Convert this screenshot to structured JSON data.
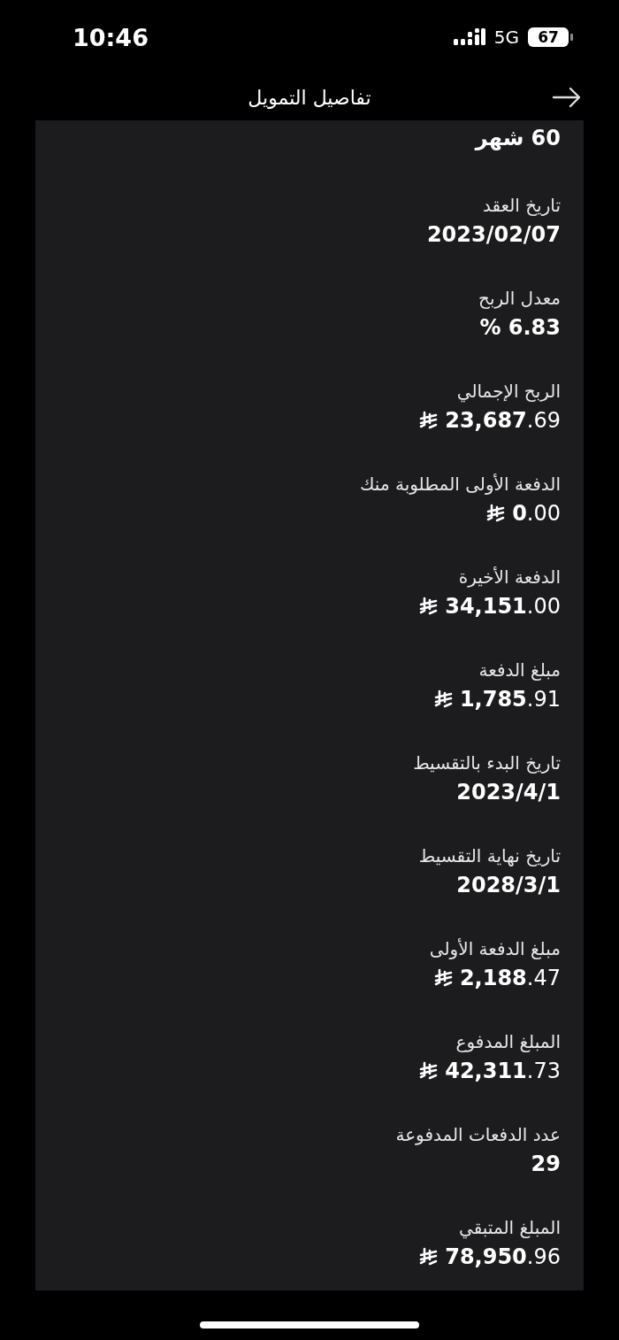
{
  "status_bar": {
    "time": "10:46",
    "network": "5G",
    "battery": "67"
  },
  "header": {
    "title": "تفاصيل التمويل"
  },
  "details": [
    {
      "kind": "text",
      "value": "60 شهر"
    },
    {
      "label": "تاريخ العقد",
      "kind": "text",
      "value": "2023/02/07"
    },
    {
      "label": "معدل الربح",
      "kind": "text",
      "value": "6.83 %"
    },
    {
      "label": "الربح الإجمالي",
      "kind": "amount",
      "value": "**23,687**.69"
    },
    {
      "label": "الدفعة الأولى المطلوبة منك",
      "kind": "amount",
      "value": "**0**.00"
    },
    {
      "label": "الدفعة الأخيرة",
      "kind": "amount",
      "value": "**34,151**.00"
    },
    {
      "label": "مبلغ الدفعة",
      "kind": "amount",
      "value": "**1,785**.91"
    },
    {
      "label": "تاريخ البدء بالتقسيط",
      "kind": "text",
      "value": "2023/4/1"
    },
    {
      "label": "تاريخ نهاية التقسيط",
      "kind": "text",
      "value": "2028/3/1"
    },
    {
      "label": "مبلغ الدفعة الأولى",
      "kind": "amount",
      "value": "**2,188**.47"
    },
    {
      "label": "المبلغ المدفوع",
      "kind": "amount",
      "value": "**42,311**.73"
    },
    {
      "label": "عدد الدفعات المدفوعة",
      "kind": "text",
      "value": "29"
    },
    {
      "label": "المبلغ المتبقي",
      "kind": "amount",
      "value": "**78,950**.96"
    }
  ]
}
